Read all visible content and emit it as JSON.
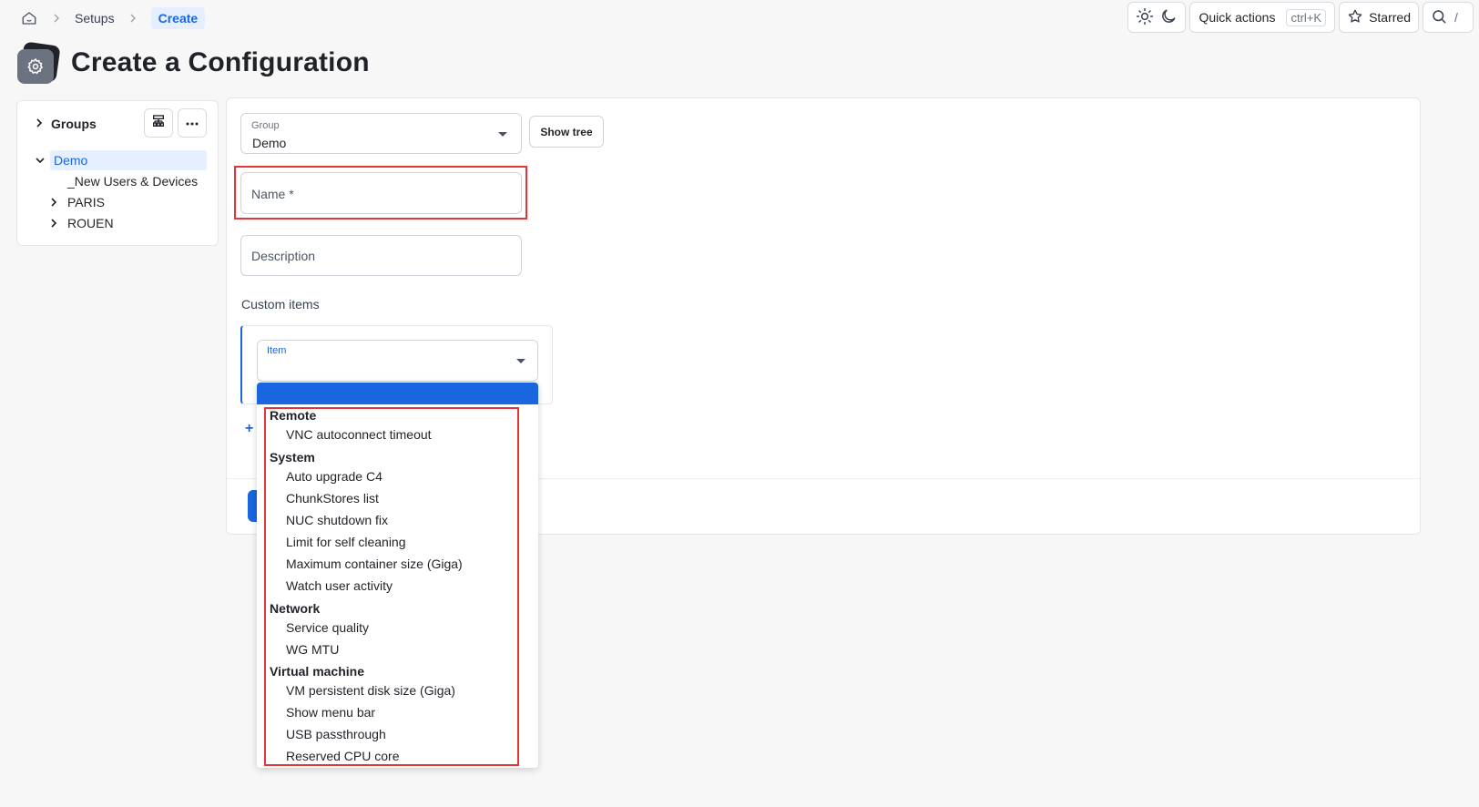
{
  "breadcrumb": {
    "home_icon": "home-icon",
    "items": [
      "Setups",
      "Create"
    ]
  },
  "topbar": {
    "theme_icons": [
      "sun-icon",
      "moon-icon"
    ],
    "quick_actions_label": "Quick actions",
    "quick_actions_shortcut": "ctrl+K",
    "starred_label": "Starred",
    "search_icon": "search-icon",
    "search_shortcut": "/"
  },
  "page": {
    "title": "Create a Configuration",
    "title_icon": "gear-icon"
  },
  "sidebar": {
    "groups_label": "Groups",
    "hierarchy_icon": "hierarchy-icon",
    "more_icon": "more-icon",
    "tree": {
      "root": "Demo",
      "children": [
        "_New Users & Devices",
        "PARIS",
        "ROUEN"
      ]
    }
  },
  "form": {
    "group_label": "Group",
    "group_value": "Demo",
    "show_tree_label": "Show tree",
    "name_placeholder": "Name *",
    "description_placeholder": "Description",
    "custom_items_label": "Custom items",
    "item_label": "Item",
    "add_icon": "+"
  },
  "dropdown": {
    "groups": [
      {
        "label": "Remote",
        "options": [
          "VNC autoconnect timeout"
        ]
      },
      {
        "label": "System",
        "options": [
          "Auto upgrade C4",
          "ChunkStores list",
          "NUC shutdown fix",
          "Limit for self cleaning",
          "Maximum container size (Giga)",
          "Watch user activity"
        ]
      },
      {
        "label": "Network",
        "options": [
          "Service quality",
          "WG MTU"
        ]
      },
      {
        "label": "Virtual machine",
        "options": [
          "VM persistent disk size (Giga)",
          "Show menu bar",
          "USB passthrough",
          "Reserved CPU core"
        ]
      }
    ]
  },
  "colors": {
    "accent": "#1a66e0",
    "highlight_box": "#e5343a",
    "background": "#f7f7f8"
  }
}
